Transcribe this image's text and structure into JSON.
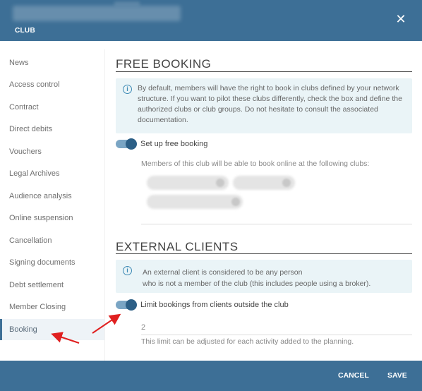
{
  "header": {
    "subtitle": "CLUB",
    "close_icon": "close-icon",
    "background": "#3d6f96"
  },
  "sidebar": {
    "items": [
      {
        "label": "News"
      },
      {
        "label": "Access control"
      },
      {
        "label": "Contract"
      },
      {
        "label": "Direct debits"
      },
      {
        "label": "Vouchers"
      },
      {
        "label": "Legal Archives"
      },
      {
        "label": "Audience analysis"
      },
      {
        "label": "Online suspension"
      },
      {
        "label": "Cancellation"
      },
      {
        "label": "Signing documents"
      },
      {
        "label": "Debt settlement"
      },
      {
        "label": "Member Closing"
      },
      {
        "label": "Booking",
        "active": true
      }
    ]
  },
  "free_booking": {
    "title": "FREE BOOKING",
    "info_lines": [
      "By default, members will have the right to book in clubs defined by your network",
      "structure. If you want to pilot these clubs differently, check the box and define the",
      "authorized clubs or club groups. Do not hesitate to consult the associated",
      "documentation."
    ],
    "toggle_label": "Set up free booking",
    "toggle_on": true,
    "clubs_intro": "Members of this club will be able to book online at the following clubs:"
  },
  "external_clients": {
    "title": "EXTERNAL CLIENTS",
    "info_lines": [
      "An external client is considered to be any person",
      "who is not a member of the club (this includes people using a broker)."
    ],
    "toggle_label": "Limit bookings from clients outside the club",
    "toggle_on": true,
    "limit_value": "2",
    "limit_hint": "This limit can be adjusted for each activity added to the planning."
  },
  "footer": {
    "cancel_label": "CANCEL",
    "save_label": "SAVE"
  },
  "colors": {
    "accent": "#3d6f96",
    "info_bg": "#eaf4f7",
    "arrow": "#e02020"
  }
}
